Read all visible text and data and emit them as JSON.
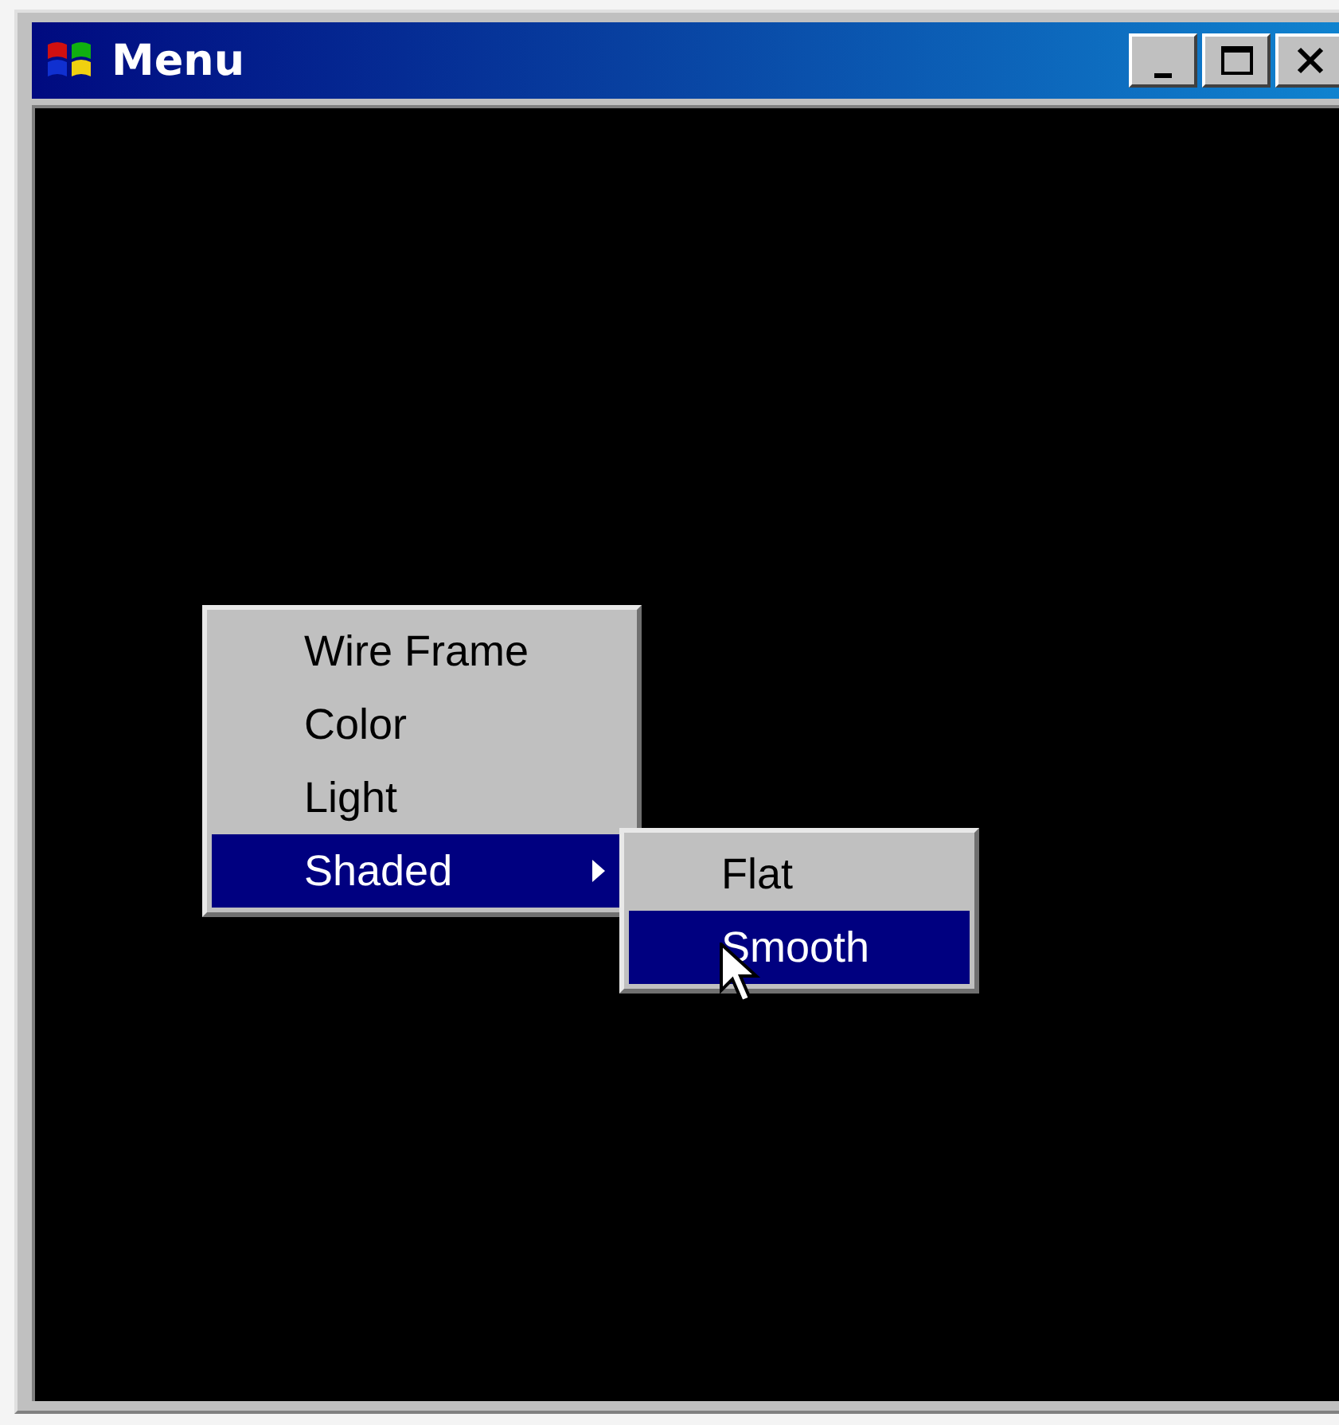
{
  "window": {
    "title": "Menu"
  },
  "menu": {
    "items": [
      {
        "label": "Wire Frame",
        "selected": false,
        "submenu": false
      },
      {
        "label": "Color",
        "selected": false,
        "submenu": false
      },
      {
        "label": "Light",
        "selected": false,
        "submenu": false
      },
      {
        "label": "Shaded",
        "selected": true,
        "submenu": true
      }
    ]
  },
  "submenu": {
    "items": [
      {
        "label": "Flat",
        "selected": false
      },
      {
        "label": "Smooth",
        "selected": true
      }
    ]
  }
}
